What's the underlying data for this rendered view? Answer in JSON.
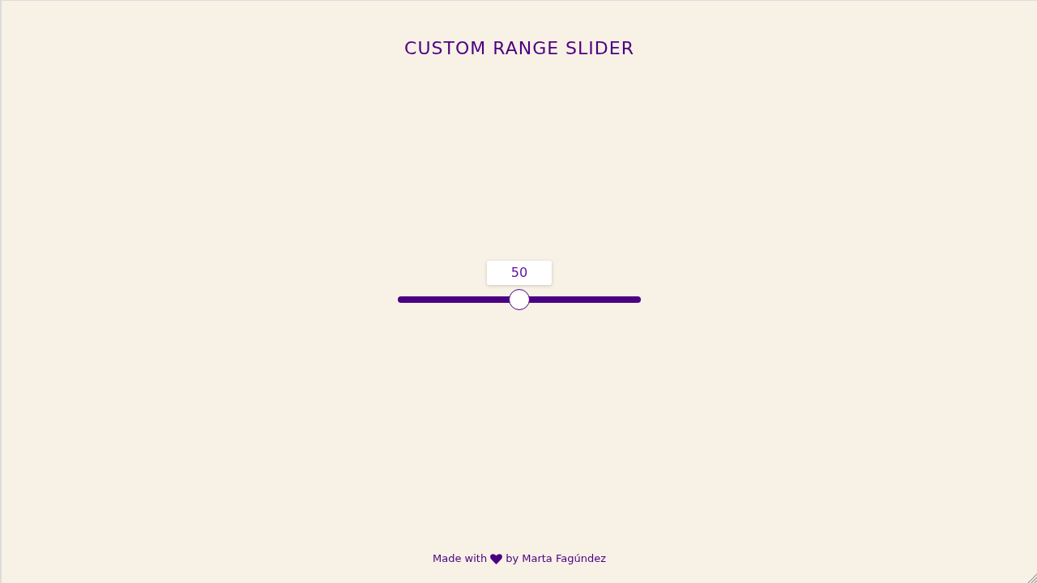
{
  "title": "CUSTOM RANGE SLIDER",
  "slider": {
    "value": "50",
    "level": 0.5
  },
  "footer": {
    "text_before": "Made with",
    "text_after": "by Marta Fagúndez"
  }
}
